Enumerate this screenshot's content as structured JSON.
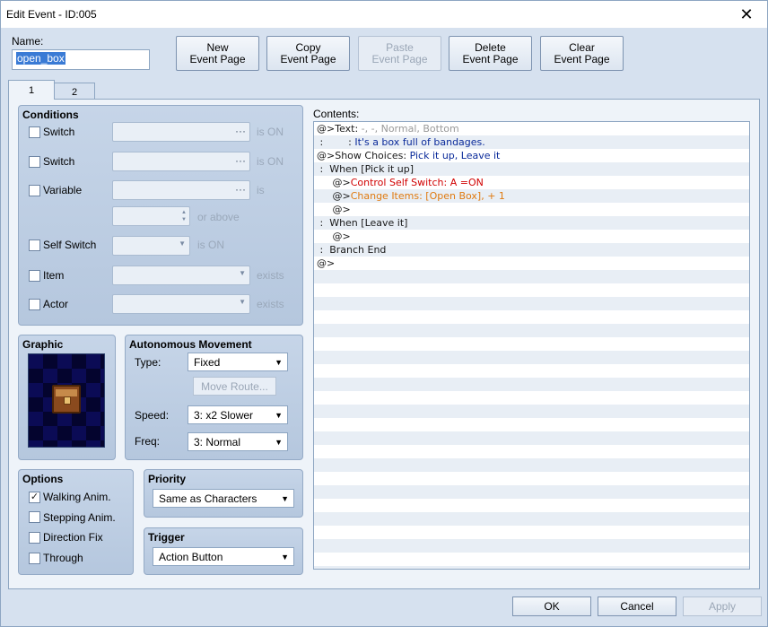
{
  "window": {
    "title": "Edit Event - ID:005",
    "close": "✕"
  },
  "name": {
    "label": "Name:",
    "value": "open_box"
  },
  "toolbar": {
    "new_page": "New\nEvent Page",
    "copy_page": "Copy\nEvent Page",
    "paste_page": "Paste\nEvent Page",
    "delete_page": "Delete\nEvent Page",
    "clear_page": "Clear\nEvent Page"
  },
  "tabs": [
    "1",
    "2"
  ],
  "conditions": {
    "title": "Conditions",
    "switch1": {
      "label": "Switch",
      "state": "is ON",
      "checked": false
    },
    "switch2": {
      "label": "Switch",
      "state": "is ON",
      "checked": false
    },
    "variable": {
      "label": "Variable",
      "state": "is",
      "suffix": "or above",
      "checked": false
    },
    "self_switch": {
      "label": "Self Switch",
      "state": "is ON",
      "checked": false
    },
    "item": {
      "label": "Item",
      "state": "exists",
      "checked": false
    },
    "actor": {
      "label": "Actor",
      "state": "exists",
      "checked": false
    }
  },
  "graphic": {
    "title": "Graphic",
    "icon": "treasure-chest"
  },
  "autonomous": {
    "title": "Autonomous Movement",
    "type_label": "Type:",
    "type_value": "Fixed",
    "move_route": "Move Route...",
    "speed_label": "Speed:",
    "speed_value": "3: x2 Slower",
    "freq_label": "Freq:",
    "freq_value": "3: Normal"
  },
  "options": {
    "title": "Options",
    "walking": {
      "label": "Walking Anim.",
      "checked": true
    },
    "stepping": {
      "label": "Stepping Anim.",
      "checked": false
    },
    "direction_fix": {
      "label": "Direction Fix",
      "checked": false
    },
    "through": {
      "label": "Through",
      "checked": false
    }
  },
  "priority": {
    "title": "Priority",
    "value": "Same as Characters"
  },
  "trigger": {
    "title": "Trigger",
    "value": "Action Button"
  },
  "contents": {
    "label": "Contents:",
    "lines": [
      {
        "parts": [
          {
            "t": "@>Text: ",
            "c": "c-dark"
          },
          {
            "t": "-, -, Normal, Bottom",
            "c": "c-gray"
          }
        ]
      },
      {
        "parts": [
          {
            "t": " :        : ",
            "c": "c-dark"
          },
          {
            "t": "It's a box full of bandages.",
            "c": "c-blue"
          }
        ]
      },
      {
        "parts": [
          {
            "t": "@>Show Choices: ",
            "c": "c-dark"
          },
          {
            "t": "Pick it up, Leave it",
            "c": "c-blue"
          }
        ]
      },
      {
        "parts": [
          {
            "t": " :  When [Pick it up]",
            "c": "c-dark"
          }
        ]
      },
      {
        "parts": [
          {
            "t": "     @>",
            "c": "c-dark"
          },
          {
            "t": "Control Self Switch: A =ON",
            "c": "c-red"
          }
        ]
      },
      {
        "parts": [
          {
            "t": "     @>",
            "c": "c-dark"
          },
          {
            "t": "Change Items: [Open Box], + 1",
            "c": "c-orange"
          }
        ]
      },
      {
        "parts": [
          {
            "t": "     @>",
            "c": "c-dark"
          }
        ]
      },
      {
        "parts": [
          {
            "t": " :  When [Leave it]",
            "c": "c-dark"
          }
        ]
      },
      {
        "parts": [
          {
            "t": "     @>",
            "c": "c-dark"
          }
        ]
      },
      {
        "parts": [
          {
            "t": " :  Branch End",
            "c": "c-dark"
          }
        ]
      },
      {
        "parts": [
          {
            "t": "@>",
            "c": "c-dark"
          }
        ]
      }
    ]
  },
  "footer": {
    "ok": "OK",
    "cancel": "Cancel",
    "apply": "Apply"
  }
}
